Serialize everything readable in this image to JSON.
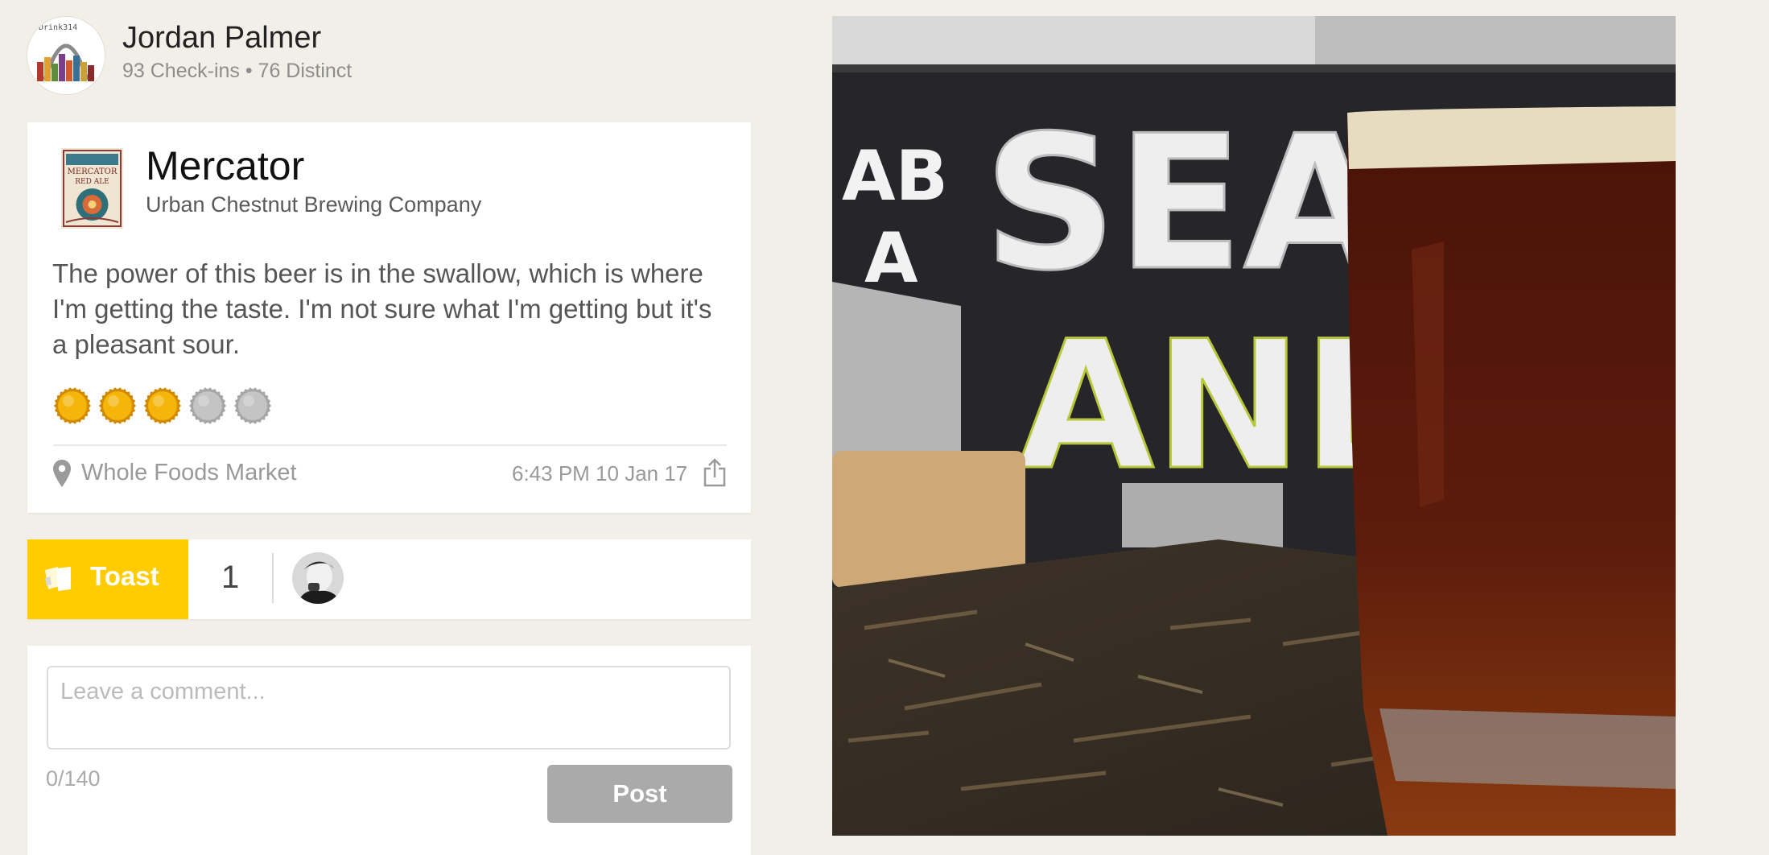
{
  "user": {
    "name": "Jordan Palmer",
    "stats": "93 Check-ins • 76 Distinct",
    "avatar_text": "Drink314"
  },
  "checkin": {
    "beer_name": "Mercator",
    "brewery": "Urban Chestnut Brewing Company",
    "review": "The power of this beer is in the swallow, which is where I'm getting the taste. I'm not sure what I'm getting but it's a pleasant sour.",
    "rating": 3,
    "rating_max": 5,
    "venue": "Whole Foods Market",
    "timestamp": "6:43 PM 10 Jan 17",
    "label_lines": [
      "MERCATOR",
      "RED ALE"
    ]
  },
  "toast": {
    "label": "Toast",
    "count": "1"
  },
  "comment": {
    "placeholder": "Leave a comment...",
    "char_count": "0/140",
    "post_label": "Post"
  },
  "photo": {
    "sign_words": [
      "AB",
      "A",
      "SEAT",
      "AND"
    ]
  },
  "colors": {
    "toast_yellow": "#ffcc00",
    "cap_gold": "#f5b50a",
    "cap_gray": "#c4c4c4",
    "background": "#f2efe8"
  }
}
